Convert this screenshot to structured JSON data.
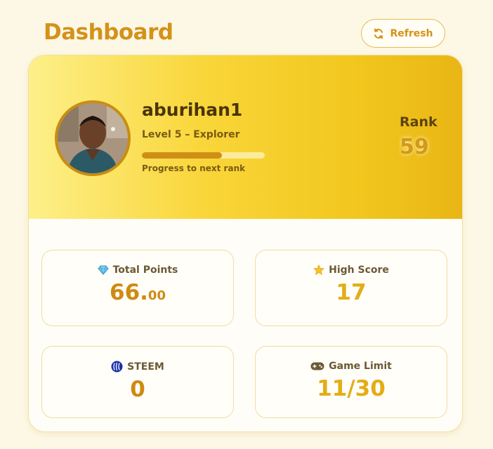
{
  "header": {
    "title": "Dashboard",
    "refresh_label": "Refresh"
  },
  "profile": {
    "username": "aburihan1",
    "level": "Level 5 – Explorer",
    "progress_fraction": 0.65,
    "progress_label": "Progress to next rank",
    "rank_label": "Rank",
    "rank_value": "59"
  },
  "stats": {
    "total_points": {
      "label": "Total Points",
      "value_int": "66.",
      "value_dec": "00",
      "icon": "gem-icon"
    },
    "high_score": {
      "label": "High Score",
      "value": "17",
      "icon": "star-icon"
    },
    "steem": {
      "label": "STEEM",
      "value": "0",
      "icon": "steem-icon"
    },
    "game_limit": {
      "label": "Game Limit",
      "value": "11/30",
      "icon": "gamepad-icon"
    }
  },
  "colors": {
    "accent": "#d4921a",
    "hero_start": "#fdf08a",
    "hero_end": "#e9b615",
    "background": "#fdf8e6"
  }
}
